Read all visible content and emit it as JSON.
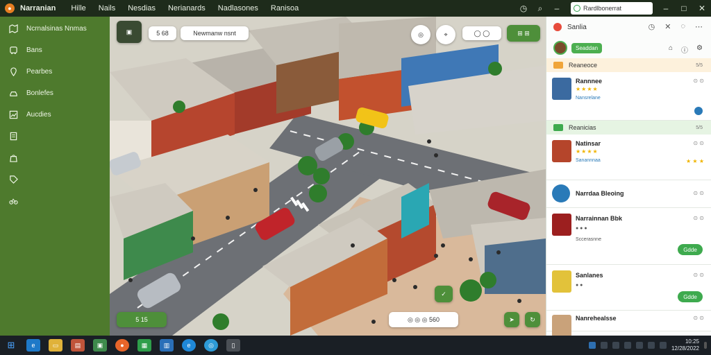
{
  "titlebar": {
    "app_name": "Narranian",
    "menu": [
      "Hille",
      "Nails",
      "Nesdias",
      "Nerianards",
      "Nadlasones",
      "Ranisoa"
    ],
    "search_text": "Rardlbonerrat"
  },
  "sidebar": {
    "items": [
      {
        "label": "Ncrnalsinas Nnmas",
        "icon": "map-icon"
      },
      {
        "label": "Bans",
        "icon": "bus-icon"
      },
      {
        "label": "Pearbes",
        "icon": "pin-icon"
      },
      {
        "label": "Bonlefes",
        "icon": "car-icon"
      },
      {
        "label": "Aucdies",
        "icon": "chart-icon"
      },
      {
        "label": "",
        "icon": "document-icon"
      },
      {
        "label": "",
        "icon": "bag-icon"
      },
      {
        "label": "",
        "icon": "tag-icon"
      },
      {
        "label": "",
        "icon": "bike-icon"
      }
    ]
  },
  "map": {
    "top_controls": {
      "zoom_text": "5 68",
      "search_text": "Newmanw nsnt",
      "right_text": "◯ ◯"
    },
    "bottom_left_text": "5  15",
    "bottom_mid_text": "◎ ◎ ◎   560"
  },
  "panel": {
    "title": "Sanlia",
    "user_pill": "Seaddan",
    "section1": {
      "title": "Reaneoce",
      "count": "5/5"
    },
    "cards1": [
      {
        "name": "Rannnee",
        "meta": "Nansrelane",
        "stars": "★★★★"
      }
    ],
    "section2": {
      "title": "Reanicias",
      "count": "5/5"
    },
    "cards2": [
      {
        "name": "Natinsar",
        "meta": "Sanannnaa",
        "stars": "★★★★",
        "button": ""
      },
      {
        "name": "Narrdaa Bleoing",
        "meta": "",
        "stars": "",
        "button": ""
      },
      {
        "name": "Narrainnan Bbk",
        "meta": "Sccerasnne",
        "stars": "",
        "button": "Gdde"
      },
      {
        "name": "Sanlanes",
        "meta": "",
        "stars": "",
        "button": "Gdde"
      },
      {
        "name": "Nanrehealsse",
        "meta": "",
        "stars": "",
        "button": ""
      }
    ]
  },
  "taskbar": {
    "apps": [
      "windows-icon",
      "edge-icon",
      "files-icon",
      "store-icon",
      "photos-icon",
      "chrome-icon",
      "sheets-icon",
      "outlook-icon",
      "browser-icon",
      "globe-icon",
      "terminal-icon"
    ],
    "time": "10:25",
    "date": "12/28/2022"
  },
  "colors": {
    "sidebar": "#4e7a2d",
    "titlebar": "#1e2b1b",
    "accent_green": "#3eaa4e",
    "taskbar": "#1a1f25"
  }
}
